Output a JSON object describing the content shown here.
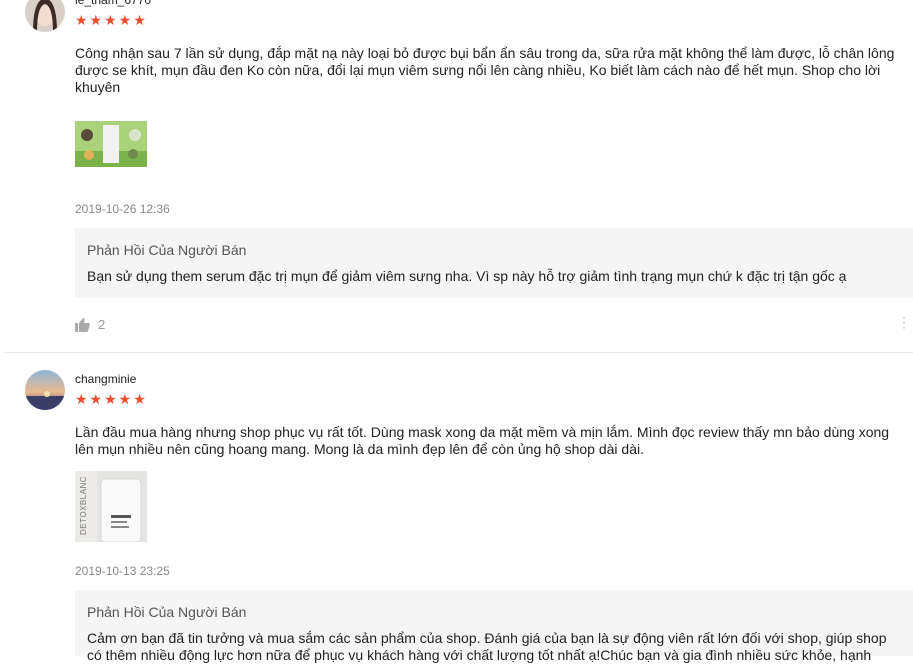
{
  "reviews": [
    {
      "username": "le_tham_6770",
      "stars": "★★★★★",
      "comment": "Công nhận sau 7 lần sử dụng, đắp mặt nạ này loại bỏ được bụi bẩn ẩn sâu trong da, sữa rửa mặt không thể làm được, lỗ chân lông được se khít, mụn đầu đen Ko còn nữa, đổi lại mụn viêm sưng nổi lên càng nhiều, Ko biết làm cách nào để hết mụn. Shop cho lời khuyên",
      "timestamp": "2019-10-26 12:36",
      "reply_title": "Phản Hồi Của Người Bán",
      "reply_text": "Bạn sử dụng them serum đặc trị mụn để  giảm viêm sưng nha. Vì sp này hỗ trợ giảm tình trạng mụn chứ k đặc trị tận gốc ạ",
      "likes": "2"
    },
    {
      "username": "changminie",
      "stars": "★★★★★",
      "comment": "Lần đầu mua hàng nhưng shop phục vụ rất tốt. Dùng mask xong da mặt mềm và mịn lắm. Mình đọc review thấy mn bảo dùng xong lên mụn nhiều nên cũng hoang mang. Mong là da mình đẹp lên để còn ủng hộ shop dài dài.",
      "product_brand": "DETOXBLANC",
      "timestamp": "2019-10-13 23:25",
      "reply_title": "Phản Hồi Của Người Bán",
      "reply_text": "Cảm ơn bạn đã tin tưởng và mua sắm các sản phẩm của shop. Đánh giá của bạn là sự động viên rất lớn đối với shop, giúp shop có thêm nhiều động lực hơn nữa để phục vụ khách hàng với chất lượng tốt nhất ạ!Chúc bạn và gia đình nhiều sức khỏe, hạnh"
    }
  ],
  "icons": {
    "like": "thumbs-up-icon",
    "more": "more-vertical-icon"
  },
  "colors": {
    "star": "#ee4d2d",
    "reply_bg": "#f5f5f5"
  }
}
